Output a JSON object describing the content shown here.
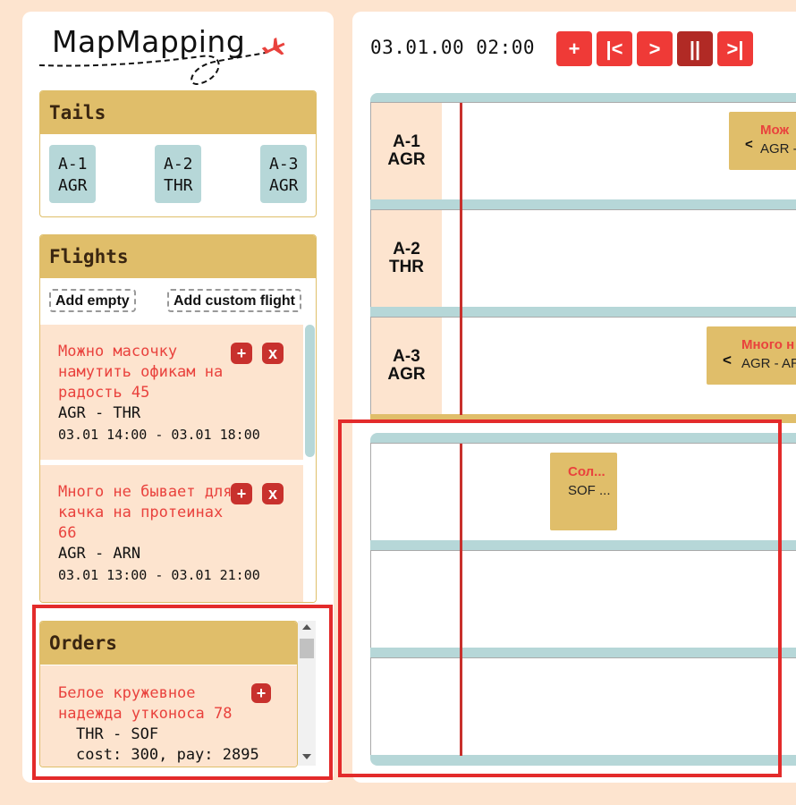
{
  "app": {
    "title": "MapMapping"
  },
  "tails": {
    "title": "Tails",
    "items": [
      {
        "id": "A-1",
        "base": "AGR"
      },
      {
        "id": "A-2",
        "base": "THR"
      },
      {
        "id": "A-3",
        "base": "AGR"
      }
    ]
  },
  "flights": {
    "title": "Flights",
    "add_empty": "Add empty",
    "add_custom": "Add custom flight",
    "items": [
      {
        "title": "Можно масочку намутить офикам на радость 45",
        "route": "AGR - THR",
        "time": "03.01 14:00 - 03.01 18:00",
        "add": "+",
        "remove": "x"
      },
      {
        "title": "Много не бывает для качка на протеинах 66",
        "route": "AGR - ARN",
        "time": "03.01 13:00 - 03.01 21:00",
        "add": "+",
        "remove": "x"
      }
    ]
  },
  "orders": {
    "title": "Orders",
    "items": [
      {
        "title": "Белое кружевное надежда утконоса 78",
        "route": "THR - SOF",
        "cost": "cost: 300, pay: 2895",
        "add": "+"
      }
    ]
  },
  "timeline": {
    "time": "03.01.00 02:00",
    "controls": [
      "+",
      "|<",
      ">",
      "||",
      ">|"
    ],
    "lanes": [
      {
        "id": "A-1",
        "base": "AGR"
      },
      {
        "id": "A-2",
        "base": "THR"
      },
      {
        "id": "A-3",
        "base": "AGR"
      }
    ],
    "blocks": [
      {
        "title": "Мож",
        "route": "AGR -",
        "arrow": "<"
      },
      {
        "title": "Много н",
        "route": "AGR - AR",
        "arrow": "<"
      },
      {
        "title": "Сол...",
        "route": "SOF ..."
      }
    ]
  },
  "colors": {
    "background": "#fde4cf",
    "header_gold": "#e0be6a",
    "tail_blue": "#b6d7d8",
    "accent_red": "#e9423d",
    "button_red": "#ef3a37",
    "highlight": "#e32b2b"
  }
}
